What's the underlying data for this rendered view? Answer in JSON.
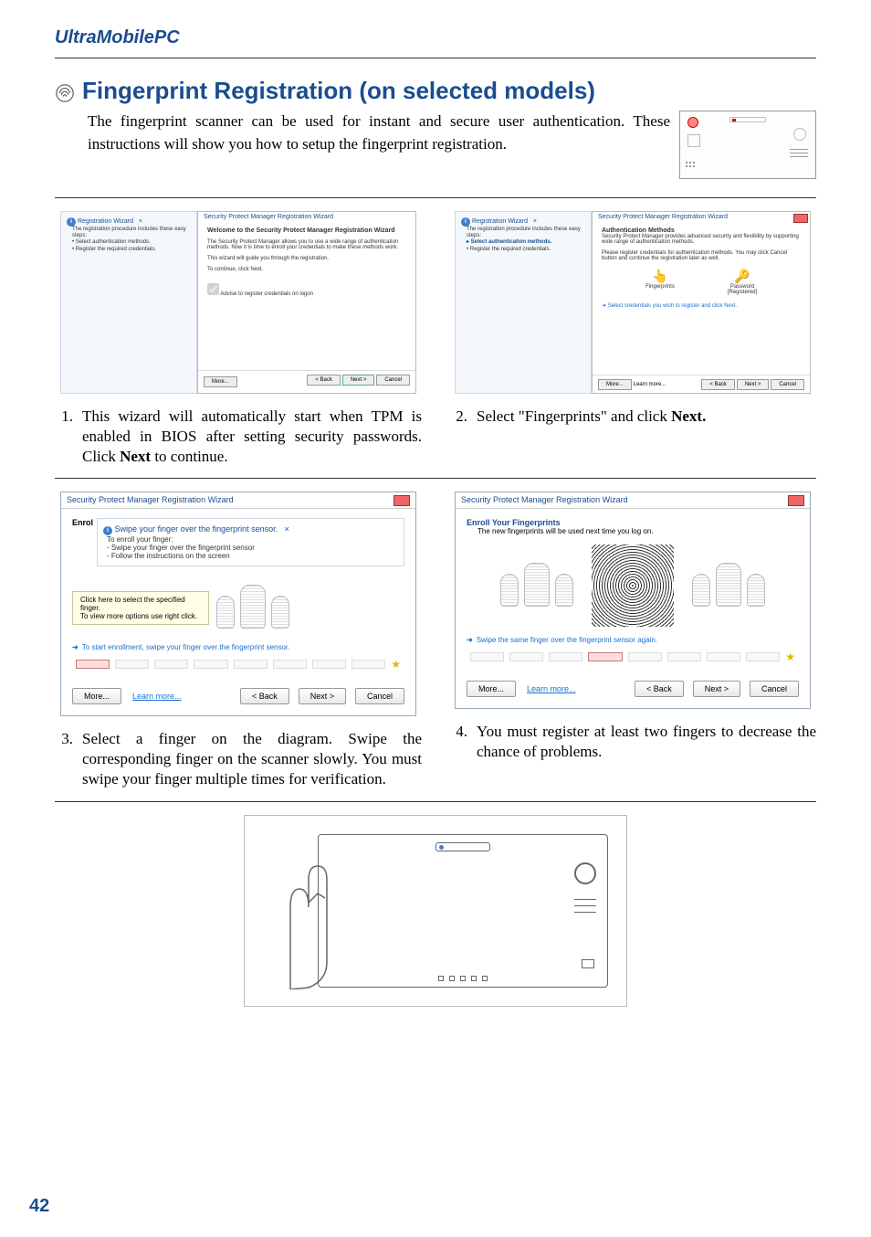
{
  "doc_header": "UltraMobilePC",
  "main_heading": "Fingerprint Registration (on selected models)",
  "intro": "The fingerprint scanner can be used for instant and secure user authentication. These instructions will show you how to setup the fingerprint registration.",
  "steps": [
    {
      "num": "1.",
      "text": "This wizard will automatically start when TPM is enabled in BIOS after setting security passwords. Click ",
      "bold": "Next",
      "tail": " to continue."
    },
    {
      "num": "2.",
      "text": "Select \"Fingerprints\" and click ",
      "bold": "Next.",
      "tail": ""
    },
    {
      "num": "3.",
      "text": "Select a finger on the diagram. Swipe the corresponding finger on the scanner slowly. You must swipe your finger multiple times for verification.",
      "bold": "",
      "tail": ""
    },
    {
      "num": "4.",
      "text": "You must register at least two fingers to decrease the chance of problems.",
      "bold": "",
      "tail": ""
    }
  ],
  "wizard_a": {
    "tip_title": "Registration Wizard",
    "tip_body": "The registration procedure includes these easy steps:",
    "tip_b1": "• Select authentication methods.",
    "tip_b2": "• Register the required credentials.",
    "title": "Security Protect Manager Registration Wizard",
    "h1": "Welcome to the Security Protect Manager Registration Wizard",
    "p1": "The Security Protect Manager allows you to use a wide range of authentication methods. Now it is time to enroll your credentials to make these methods work.",
    "p2": "This wizard will guide you through the registration.",
    "p3": "To continue, click Next.",
    "cb": "Advise to register credentials on logon",
    "more": "More...",
    "back": "< Back",
    "next": "Next >",
    "cancel": "Cancel"
  },
  "wizard_b": {
    "tip_title": "Registration Wizard",
    "tip_body": "The registration procedure includes these easy steps:",
    "tip_b1": "▸ Select authentication methods.",
    "tip_b2": "• Register the required credentials.",
    "title": "Security Protect Manager Registration Wizard",
    "h1": "Authentication Methods",
    "p1": "Security Protect Manager provides advanced security and flexibility by supporting wide range of authentication methods.",
    "p2": "Please register credentials for authentication methods. You may click Cancel button and continue the registration later as well.",
    "fingerprints": "Fingerprints",
    "password": "Password",
    "registered": "[Registered]",
    "hint": "Select credentials you wish to register and click Next.",
    "more": "More...",
    "learn": "Learn more...",
    "back": "< Back",
    "next": "Next >",
    "cancel": "Cancel"
  },
  "wizard_c": {
    "title": "Security Protect Manager Registration Wizard",
    "enroll_prefix": "Enrol",
    "tip_title": "Swipe your finger over the fingerprint sensor.",
    "tip_l1": "To enroll your finger:",
    "tip_l2": "- Swipe your finger over the fingerprint sensor",
    "tip_l3": "- Follow the instructions on the screen",
    "tooltip": "Click here to select the specified finger.\nTo view more options use right click.",
    "hint": "To start enrollment, swipe your finger over the fingerprint sensor.",
    "more": "More...",
    "learn": "Learn more...",
    "back": "< Back",
    "next": "Next >",
    "cancel": "Cancel"
  },
  "wizard_d": {
    "title": "Security Protect Manager Registration Wizard",
    "h1": "Enroll Your Fingerprints",
    "p1": "The new fingerprints will be used next time you log on.",
    "hint": "Swipe the same finger over the fingerprint sensor again.",
    "more": "More...",
    "learn": "Learn more...",
    "back": "< Back",
    "next": "Next >",
    "cancel": "Cancel"
  },
  "page_number": "42"
}
